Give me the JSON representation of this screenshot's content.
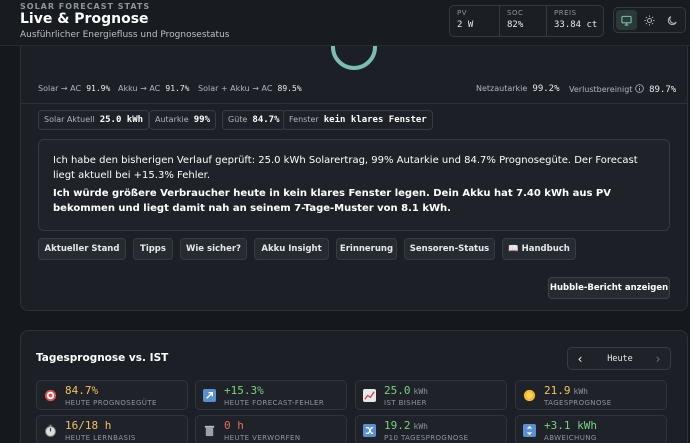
{
  "header": {
    "kicker": "SOLAR FORECAST STATS",
    "title": "Live & Prognose",
    "subtitle": "Ausführlicher Energiefluss und Prognosestatus",
    "stats": [
      {
        "label": "PV",
        "value": "2 W"
      },
      {
        "label": "SOC",
        "value": "82%"
      },
      {
        "label": "PREIS",
        "value": "33.84 ct"
      }
    ],
    "theme_buttons": [
      "monitor-icon",
      "sun-icon",
      "moon-icon"
    ],
    "active_theme": "monitor-icon"
  },
  "efficiency": {
    "solar_ac_label": "Solar → AC",
    "solar_ac_value": "91.9%",
    "akku_ac_label": "Akku → AC",
    "akku_ac_value": "91.7%",
    "solar_akku_ac_label": "Solar + Akku → AC",
    "solar_akku_ac_value": "89.5%",
    "netzautarkie_label": "Netzautarkie",
    "netzautarkie_value": "99.2%",
    "verlust_label": "Verlustbereinigt",
    "verlust_value": "89.7%"
  },
  "chips": [
    {
      "label": "Solar Aktuell",
      "value": "25.0 kWh"
    },
    {
      "label": "Autarkie",
      "value": "99%"
    },
    {
      "label": "Güte",
      "value": "84.7%"
    },
    {
      "label": "Fenster",
      "value": "kein klares Fenster"
    }
  ],
  "message": {
    "p1": "Ich habe den bisherigen Verlauf geprüft: 25.0 kWh Solarertrag, 99% Autarkie und 84.7% Prognosegüte. Der Forecast liegt aktuell bei +15.3% Fehler.",
    "p2": "Ich würde größere Verbraucher heute in kein klares Fenster legen. Dein Akku hat 7.40 kWh aus PV bekommen und liegt damit nah an seinem 7-Tage-Muster von 8.1 kWh."
  },
  "tabs": [
    "Aktueller Stand",
    "Tipps",
    "Wie sicher?",
    "Akku Insight",
    "Erinnerung",
    "Sensoren-Status",
    "📖 Handbuch"
  ],
  "hubble_button": "Hubble-Bericht anzeigen",
  "forecast": {
    "title": "Tagesprognose vs. IST",
    "nav_label": "Heute",
    "nav_prev": "‹",
    "nav_next": "›",
    "metrics": [
      {
        "icon": "target-icon",
        "value": "84.7%",
        "unit": "",
        "label": "HEUTE PROGNOSEGÜTE",
        "color": "#f0c060"
      },
      {
        "icon": "trend-arrow-icon",
        "value": "+15.3%",
        "unit": "",
        "label": "HEUTE FORECAST-FEHLER",
        "color": "#7ccf83"
      },
      {
        "icon": "chart-icon",
        "value": "25.0",
        "unit": "kWh",
        "label": "IST BISHER",
        "color": "#7ccf83"
      },
      {
        "icon": "sun-icon",
        "value": "21.9",
        "unit": "kWh",
        "label": "TAGESPROGNOSE",
        "color": "#f0c060"
      },
      {
        "icon": "stopwatch-icon",
        "value": "16/18 h",
        "unit": "",
        "label": "HEUTE LERNBASIS",
        "color": "#f0c060"
      },
      {
        "icon": "trash-icon",
        "value": "0 h",
        "unit": "",
        "label": "HEUTE VERWORFEN",
        "color": "#e0705c"
      },
      {
        "icon": "shuffle-icon",
        "value": "19.2",
        "unit": "kWh",
        "label": "P10 TAGESPROGNOSE",
        "color": "#7ccf83"
      },
      {
        "icon": "up-down-icon",
        "value": "+3.1 kWh",
        "unit": "",
        "label": "ABWEICHUNG",
        "color": "#7ccf83"
      }
    ]
  }
}
